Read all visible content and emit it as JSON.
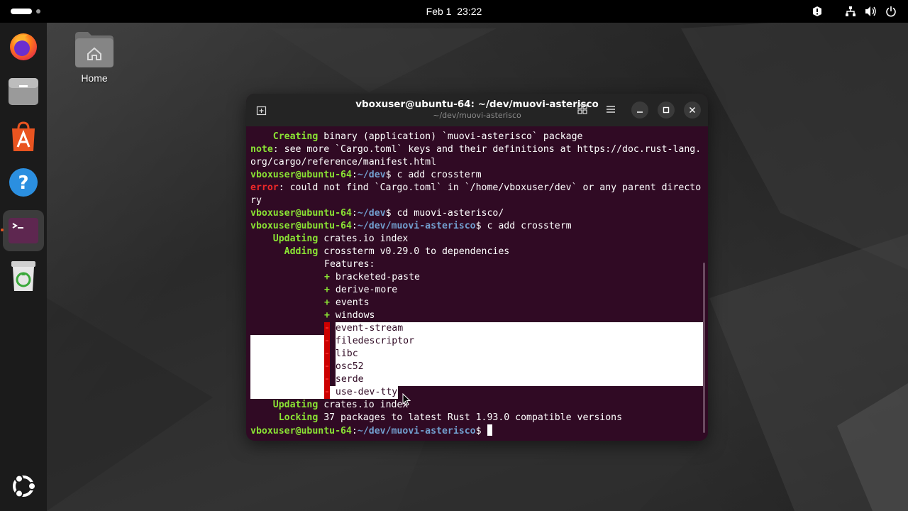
{
  "topbar": {
    "date": "Feb 1",
    "time": "23:22"
  },
  "desktop": {
    "home_label": "Home"
  },
  "terminal": {
    "title": "vboxuser@ubuntu-64: ~/dev/muovi-asterisco",
    "subtitle": "~/dev/muovi-asterisco",
    "prompt_user": "vboxuser@ubuntu-64",
    "lines": {
      "l1_kw": "Creating",
      "l1_rest": " binary (application) `muovi-asterisco` package",
      "l2_kw": "note",
      "l2_rest": ": see more `Cargo.toml` keys and their definitions at https://doc.rust-lang.",
      "l3": "org/cargo/reference/manifest.html",
      "l4_path": "~/dev",
      "l4_cmd": "$ c add crossterm",
      "l5_kw": "error",
      "l5_rest": ": could not find `Cargo.toml` in `/home/vboxuser/dev` or any parent directo",
      "l6": "ry",
      "l7_path": "~/dev",
      "l7_cmd": "$ cd muovi-asterisco/",
      "l8_path": "~/dev/muovi-asterisco",
      "l8_cmd": "$ c add crossterm",
      "l9_kw": "Updating",
      "l9_rest": " crates.io index",
      "l10_kw": "Adding",
      "l10_rest": " crossterm v0.29.0 to dependencies",
      "l11": "Features:",
      "plus": "+",
      "minus": "-",
      "feat_on": [
        "bracketed-paste",
        "derive-more",
        "events",
        "windows"
      ],
      "feat_off": [
        "event-stream",
        "filedescriptor",
        "libc",
        "osc52",
        "serde",
        "use-dev-tty"
      ],
      "l22_kw": "Updating",
      "l22_rest": " crates.io index",
      "l23_kw": "Locking",
      "l23_rest": " 37 packages to latest Rust 1.93.0 compatible versions",
      "l24_path": "~/dev/muovi-asterisco",
      "l24_cmd": "$ "
    }
  },
  "colors": {
    "terminal_bg": "#300a24",
    "green": "#8ae234",
    "blue": "#729fcf",
    "red": "#ef2929",
    "accent": "#e95420"
  }
}
